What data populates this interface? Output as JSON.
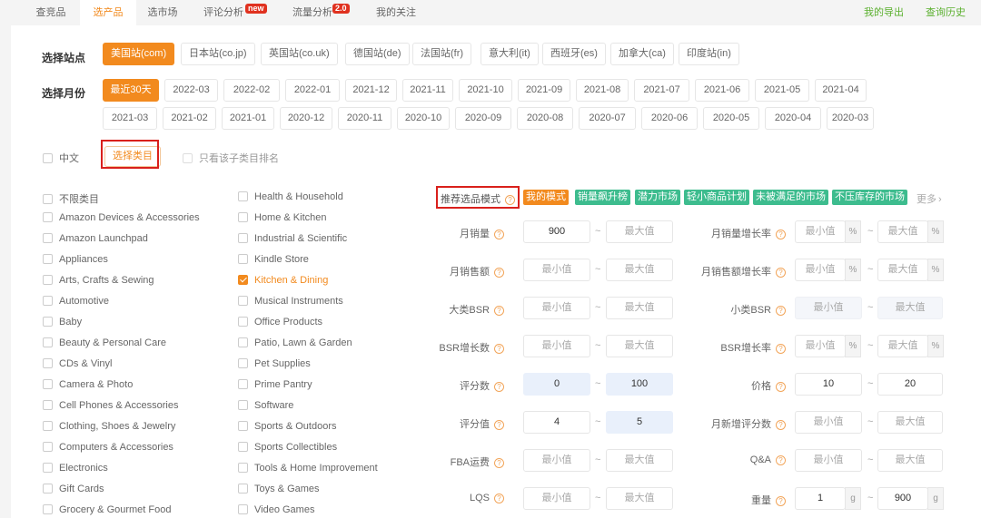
{
  "tabs": [
    {
      "label": "查竞品"
    },
    {
      "label": "选产品"
    },
    {
      "label": "选市场"
    },
    {
      "label": "评论分析",
      "badge": "new"
    },
    {
      "label": "流量分析",
      "badge": "2.0"
    },
    {
      "label": "我的关注"
    }
  ],
  "top_links": [
    "我的导出",
    "查询历史"
  ],
  "sites": {
    "label": "选择站点",
    "items": [
      "美国站(com)",
      "日本站(co.jp)",
      "英国站(co.uk)",
      "德国站(de)",
      "法国站(fr)",
      "意大利(it)",
      "西班牙(es)",
      "加拿大(ca)",
      "印度站(in)"
    ]
  },
  "months": {
    "label": "选择月份",
    "row1": [
      "最近30天",
      "2022-03",
      "2022-02",
      "2022-01",
      "2021-12",
      "2021-11",
      "2021-10",
      "2021-09",
      "2021-08",
      "2021-07",
      "2021-06",
      "2021-05",
      "2021-04"
    ],
    "row2": [
      "2021-03",
      "2021-02",
      "2021-01",
      "2020-12",
      "2020-11",
      "2020-10",
      "2020-09",
      "2020-08",
      "2020-07",
      "2020-06",
      "2020-05",
      "2020-04",
      "2020-03"
    ]
  },
  "options": {
    "chinese": "中文",
    "select_category": "选择类目",
    "only_sub": "只看该子类目排名"
  },
  "categories_col1": [
    "不限类目",
    "Amazon Devices & Accessories",
    "Amazon Launchpad",
    "Appliances",
    "Arts, Crafts & Sewing",
    "Automotive",
    "Baby",
    "Beauty & Personal Care",
    "CDs & Vinyl",
    "Camera & Photo",
    "Cell Phones & Accessories",
    "Clothing, Shoes & Jewelry",
    "Computers & Accessories",
    "Electronics",
    "Gift Cards",
    "Grocery & Gourmet Food"
  ],
  "categories_col2": [
    "Health & Household",
    "Home & Kitchen",
    "Industrial & Scientific",
    "Kindle Store",
    "Kitchen & Dining",
    "Musical Instruments",
    "Office Products",
    "Patio, Lawn & Garden",
    "Pet Supplies",
    "Prime Pantry",
    "Software",
    "Sports & Outdoors",
    "Sports Collectibles",
    "Tools & Home Improvement",
    "Toys & Games",
    "Video Games"
  ],
  "checked_category": "Kitchen & Dining",
  "modes": {
    "label": "推荐选品模式",
    "items": [
      "我的模式",
      "销量飙升榜",
      "潜力市场",
      "轻小商品计划",
      "未被满足的市场",
      "不压库存的市场"
    ],
    "more": "更多"
  },
  "filters_left": [
    {
      "label": "月销量",
      "min": "900",
      "max": "最大值"
    },
    {
      "label": "月销售额",
      "min": "最小值",
      "max": "最大值"
    },
    {
      "label": "大类BSR",
      "min": "最小值",
      "max": "最大值"
    },
    {
      "label": "BSR增长数",
      "min": "最小值",
      "max": "最大值"
    },
    {
      "label": "评分数",
      "min": "0",
      "max": "100"
    },
    {
      "label": "评分值",
      "min": "4",
      "max": "5"
    },
    {
      "label": "FBA运费",
      "min": "最小值",
      "max": "最大值"
    },
    {
      "label": "LQS",
      "min": "最小值",
      "max": "最大值"
    }
  ],
  "filters_right": [
    {
      "label": "月销量增长率",
      "min": "最小值",
      "max": "最大值",
      "unit": "%"
    },
    {
      "label": "月销售额增长率",
      "min": "最小值",
      "max": "最大值",
      "unit": "%"
    },
    {
      "label": "小类BSR",
      "min": "最小值",
      "max": "最大值",
      "unit": ""
    },
    {
      "label": "BSR增长率",
      "min": "最小值",
      "max": "最大值",
      "unit": "%"
    },
    {
      "label": "价格",
      "min": "10",
      "max": "20",
      "unit": ""
    },
    {
      "label": "月新增评分数",
      "min": "最小值",
      "max": "最大值",
      "unit": ""
    },
    {
      "label": "Q&A",
      "min": "最小值",
      "max": "最大值",
      "unit": ""
    },
    {
      "label": "重量",
      "min": "1",
      "max": "900",
      "unit": "g"
    }
  ],
  "colors": {
    "accent": "#f28a1e",
    "mode_green": "#3dbc8e",
    "highlight": "#d9201c"
  }
}
